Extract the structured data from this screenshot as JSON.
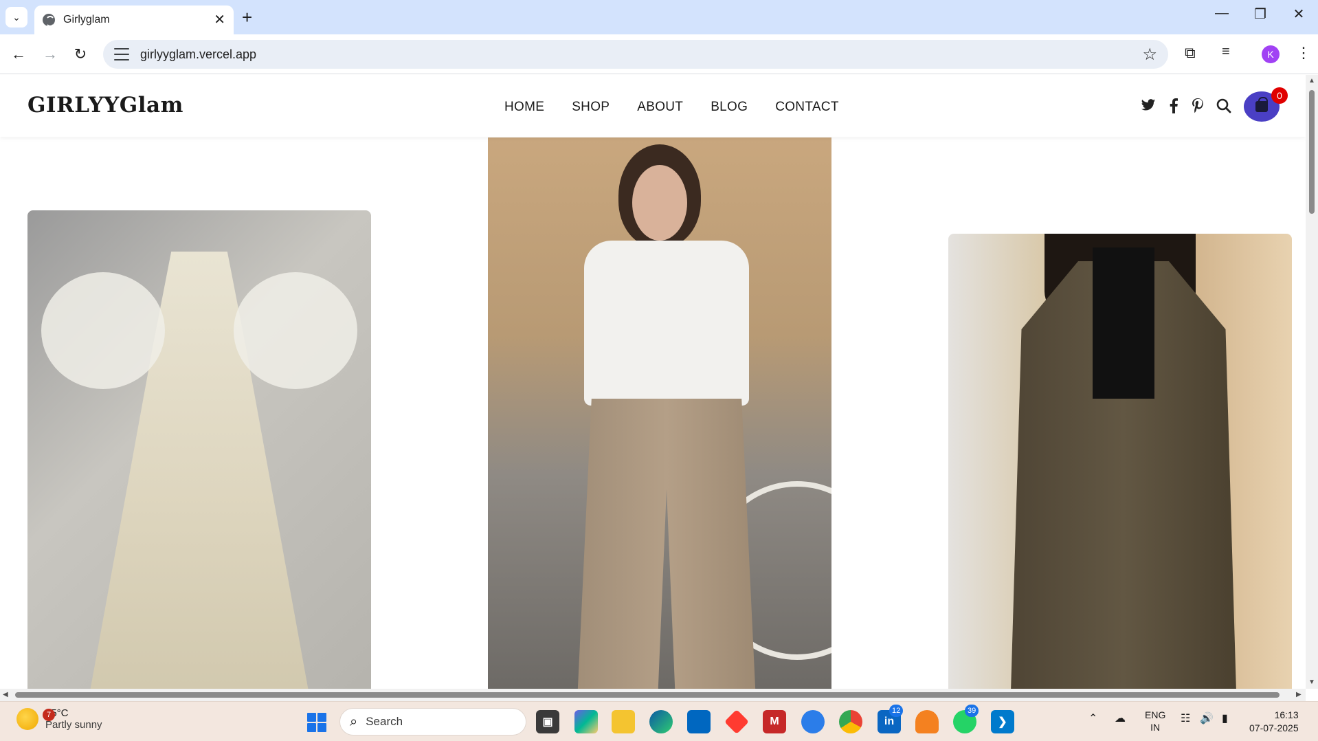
{
  "browser": {
    "tab_title": "Girlyglam",
    "url": "girlyyglam.vercel.app",
    "profile_initial": "K",
    "tab_close": "✕",
    "new_tab": "+"
  },
  "site": {
    "logo": "GIRLYYGlam",
    "nav": [
      "HOME",
      "SHOP",
      "ABOUT",
      "BLOG",
      "CONTACT"
    ],
    "cart_count": "0",
    "icons": [
      "twitter-icon",
      "facebook-icon",
      "pinterest-icon",
      "search-icon",
      "shopping-bag-icon"
    ],
    "accent_color": "#4a3fc4",
    "badge_color": "#e00000"
  },
  "taskbar": {
    "weather_temp": "35°C",
    "weather_cond": "Partly sunny",
    "weather_badge": "7",
    "search_placeholder": "Search",
    "linkedin_badge": "12",
    "whatsapp_badge": "39",
    "lang_top": "ENG",
    "lang_bottom": "IN",
    "time": "16:13",
    "date": "07-07-2025"
  }
}
